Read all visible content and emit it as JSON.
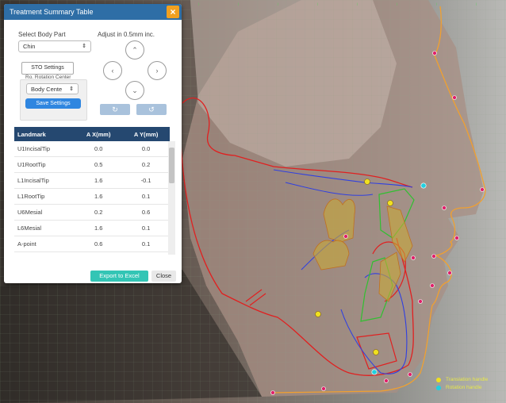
{
  "panel": {
    "title": "Treatment Summary Table",
    "select_body_part_label": "Select Body Part",
    "body_part_value": "Chin",
    "adjust_label": "Adjust in 0.5mm inc.",
    "sto_settings_tab": "STO Settings",
    "rotation_center_label": "Ro. Rotation Center",
    "rotation_center_value": "Body Cente",
    "save_settings_button": "Save Settings",
    "arrow_up": "⌃",
    "arrow_left": "‹",
    "arrow_right": "›",
    "arrow_down": "⌄",
    "rotate_cw_icon": "↻",
    "rotate_ccw_icon": "↺",
    "table": {
      "headers": [
        "Landmark",
        "A X(mm)",
        "A Y(mm)"
      ],
      "rows": [
        [
          "U1IncisalTip",
          "0.0",
          "0.0"
        ],
        [
          "U1RootTip",
          "0.5",
          "0.2"
        ],
        [
          "L1IncisalTip",
          "1.6",
          "-0.1"
        ],
        [
          "L1RootTip",
          "1.6",
          "0.1"
        ],
        [
          "U6Mesial",
          "0.2",
          "0.6"
        ],
        [
          "L6Mesial",
          "1.6",
          "0.1"
        ],
        [
          "A-point",
          "0.6",
          "0.1"
        ]
      ]
    },
    "export_button": "Export to Excel",
    "close_button": "Close"
  },
  "legend": {
    "translation_label": "Translation handle",
    "rotation_label": "Rotation handle",
    "translation_color": "#f0e020",
    "rotation_color": "#20d0e0"
  },
  "colors": {
    "title_bar": "#2e6ea6",
    "close_button": "#f0a020",
    "table_header": "#254870",
    "export_button": "#33c5b5",
    "save_button": "#2f86e0",
    "soft_tissue_outline": "#f0a030",
    "red_outline": "#e02020",
    "blue_outline": "#3040e0",
    "green_outline": "#30c030"
  }
}
